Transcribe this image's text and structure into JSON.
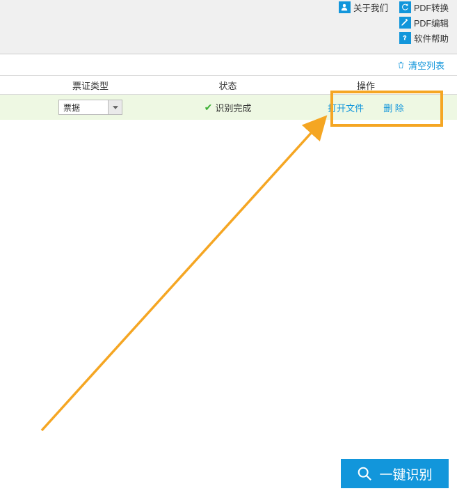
{
  "top": {
    "about": "关于我们",
    "pdf_convert": "PDF转换",
    "pdf_edit": "PDF编辑",
    "help": "软件帮助"
  },
  "clear_list": "清空列表",
  "headers": {
    "type": "票证类型",
    "status": "状态",
    "op": "操作"
  },
  "row": {
    "type": "票据",
    "status": "识别完成",
    "open": "打开文件",
    "delete": "删 除"
  },
  "action": "一键识别"
}
